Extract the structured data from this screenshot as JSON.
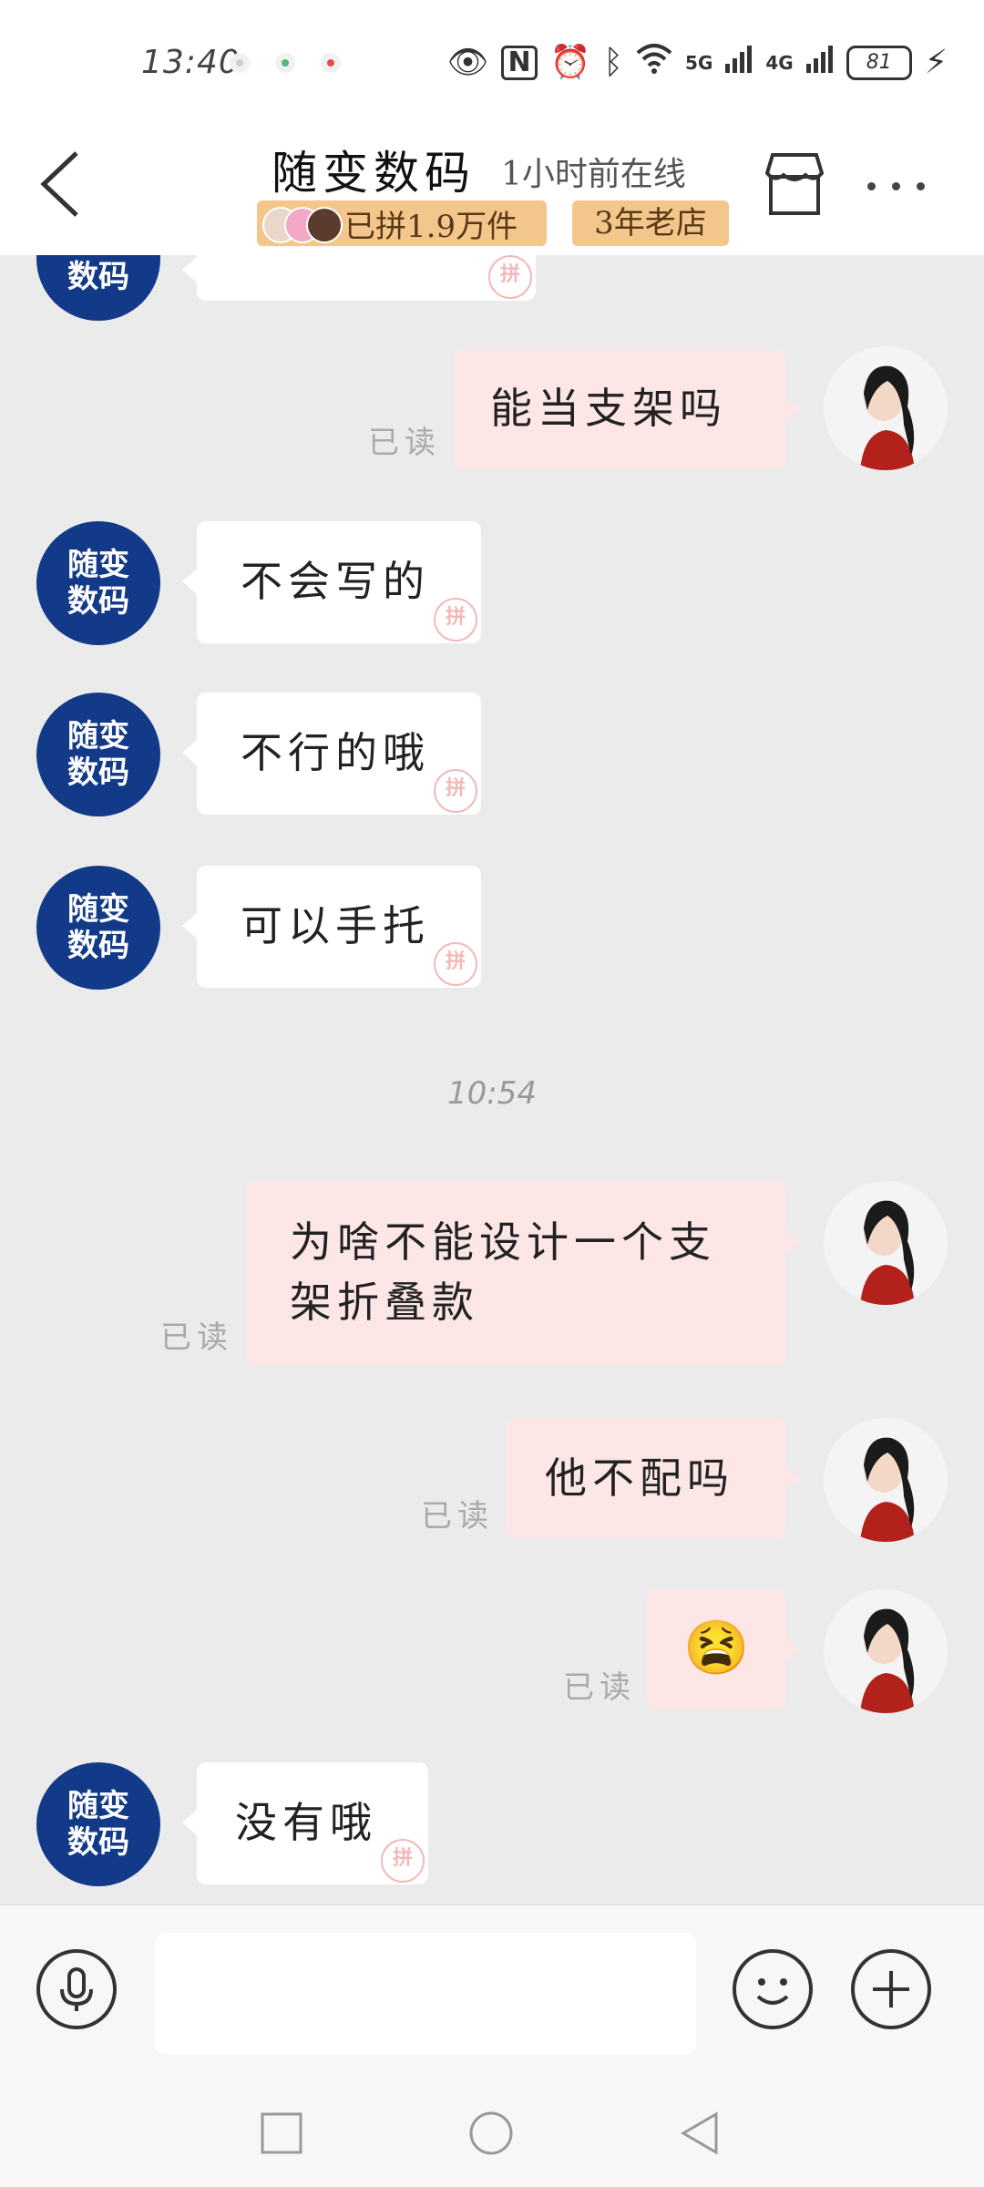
{
  "status_bar": {
    "time": "13:40",
    "network_5g": "5G",
    "network_4g": "4G",
    "battery": "81"
  },
  "header": {
    "shop_name": "随变数码",
    "online_status": "1小时前在线",
    "pinned_badge": "已拼1.9万件",
    "years_badge": "3年老店"
  },
  "shop_avatar_text": "随变\n数码",
  "messages": [
    {
      "from": "shop",
      "text": "",
      "read": ""
    },
    {
      "from": "user",
      "text": "能当支架吗",
      "read": "已读"
    },
    {
      "from": "shop",
      "text": "不会写的",
      "read": ""
    },
    {
      "from": "shop",
      "text": "不行的哦",
      "read": ""
    },
    {
      "from": "shop",
      "text": "可以手托",
      "read": ""
    },
    {
      "from": "user",
      "text": "为啥不能设计一个支架折叠款",
      "read": "已读"
    },
    {
      "from": "user",
      "text": "他不配吗",
      "read": "已读"
    },
    {
      "from": "user",
      "text": "😫",
      "read": "已读"
    },
    {
      "from": "shop",
      "text": "没有哦",
      "read": ""
    }
  ],
  "timestamp": "10:54",
  "input": {
    "placeholder": "",
    "value": ""
  }
}
